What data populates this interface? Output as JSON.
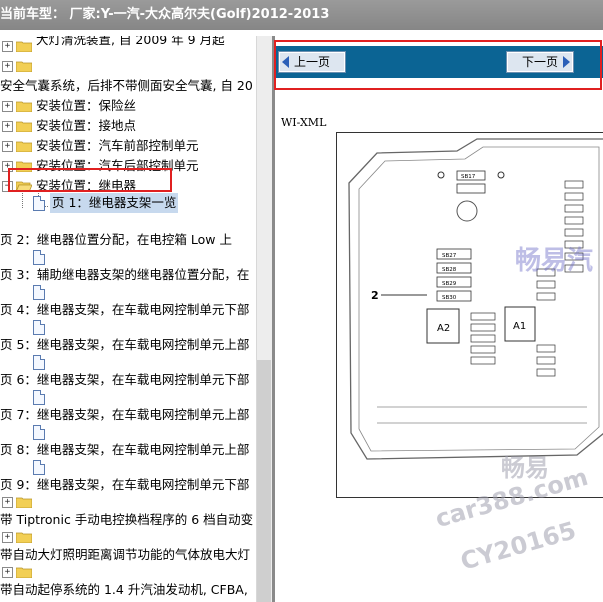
{
  "window": {
    "title": "当前车型：  厂家:Y-一汽-大众高尔夫(Golf)2012-2013"
  },
  "tree": {
    "items": [
      {
        "label": "大灯清洗装置, 自 2009 年 9 月起",
        "indent": "top"
      },
      {
        "label": "",
        "indent": "folder-only"
      },
      {
        "label": "安全气囊系统，后排不带侧面安全气囊, 自 20",
        "indent": "text-only"
      },
      {
        "label": "安装位置：保险丝"
      },
      {
        "label": "安装位置：接地点"
      },
      {
        "label": "安装位置：汽车前部控制单元"
      },
      {
        "label": "安装位置：汽车后部控制单元"
      },
      {
        "label": "安装位置：继电器"
      },
      {
        "label": "页 1：继电器支架一览"
      },
      {
        "label": "页 2：继电器位置分配，在电控箱 Low 上"
      },
      {
        "label": "页 3：辅助继电器支架的继电器位置分配，在"
      },
      {
        "label": "页 4：继电器支架，在车载电网控制单元下部"
      },
      {
        "label": "页 5：继电器支架，在车载电网控制单元上部"
      },
      {
        "label": "页 6：继电器支架，在车载电网控制单元下部"
      },
      {
        "label": "页 7：继电器支架，在车载电网控制单元上部"
      },
      {
        "label": "页 8：继电器支架，在车载电网控制单元上部"
      },
      {
        "label": "页 9：继电器支架，在车载电网控制单元下部"
      },
      {
        "label": "带 Tiptronic 手动电控换档程序的 6 档自动变"
      },
      {
        "label": "带自动大灯照明距离调节功能的气体放电大灯"
      },
      {
        "label": "带自动起停系统的 1.4 升汽油发动机, CFBA,"
      }
    ]
  },
  "nav": {
    "prev_label": "上一页",
    "next_label": "下一页"
  },
  "doc": {
    "heading": "WI-XML",
    "callout": "2"
  },
  "diagram_labels": [
    "SB17",
    "SB27",
    "SB28",
    "SB29",
    "SB30",
    "SB31",
    "A2",
    "A1"
  ],
  "watermarks": [
    "畅易汽",
    "畅易",
    "car388.com",
    "CY20165"
  ],
  "colors": {
    "titlebar": "#8e8e8e",
    "navbar": "#0b6494",
    "highlight": "#e02020",
    "selected": "#c7d9ee"
  }
}
